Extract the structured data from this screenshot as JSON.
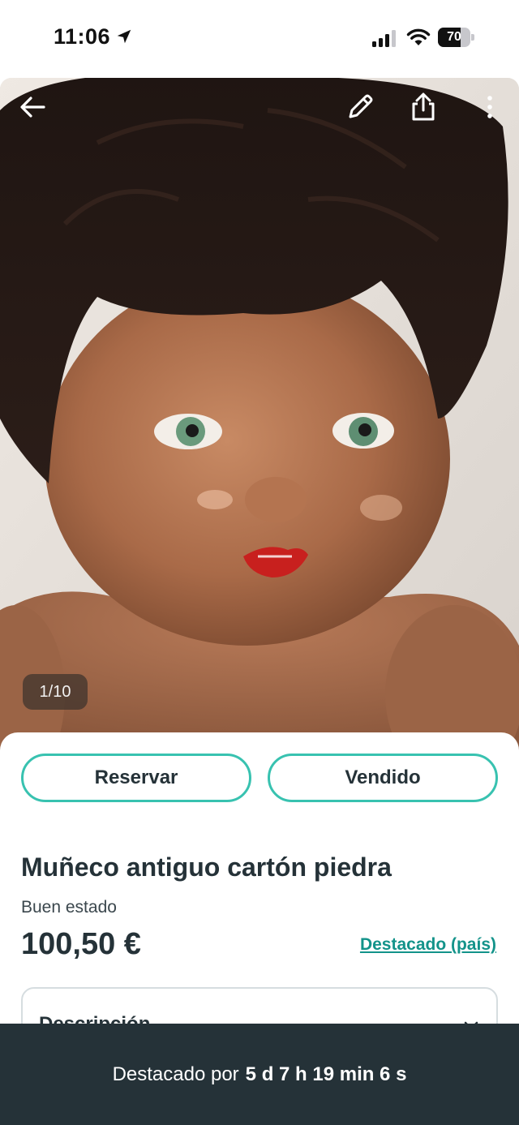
{
  "status_bar": {
    "time": "11:06",
    "battery_level": "70",
    "battery_fraction": 0.7
  },
  "photo": {
    "counter": "1/10",
    "icons": [
      "arrow-left-icon",
      "pencil-icon",
      "share-icon",
      "more-vertical-icon"
    ]
  },
  "actions": {
    "reserve_label": "Reservar",
    "sold_label": "Vendido"
  },
  "product": {
    "title": "Muñeco antiguo cartón piedra",
    "condition": "Buen estado",
    "price": "100,50 €",
    "featured_link": "Destacado (país)"
  },
  "description": {
    "title": "Descripción"
  },
  "bottom_bar": {
    "prefix": "Destacado por",
    "remaining": "5 d 7 h 19 min 6 s"
  },
  "colors": {
    "accent": "#38c2b0",
    "link": "#13938a",
    "dark": "#253238",
    "bottom_bar_bg": "#253238"
  }
}
